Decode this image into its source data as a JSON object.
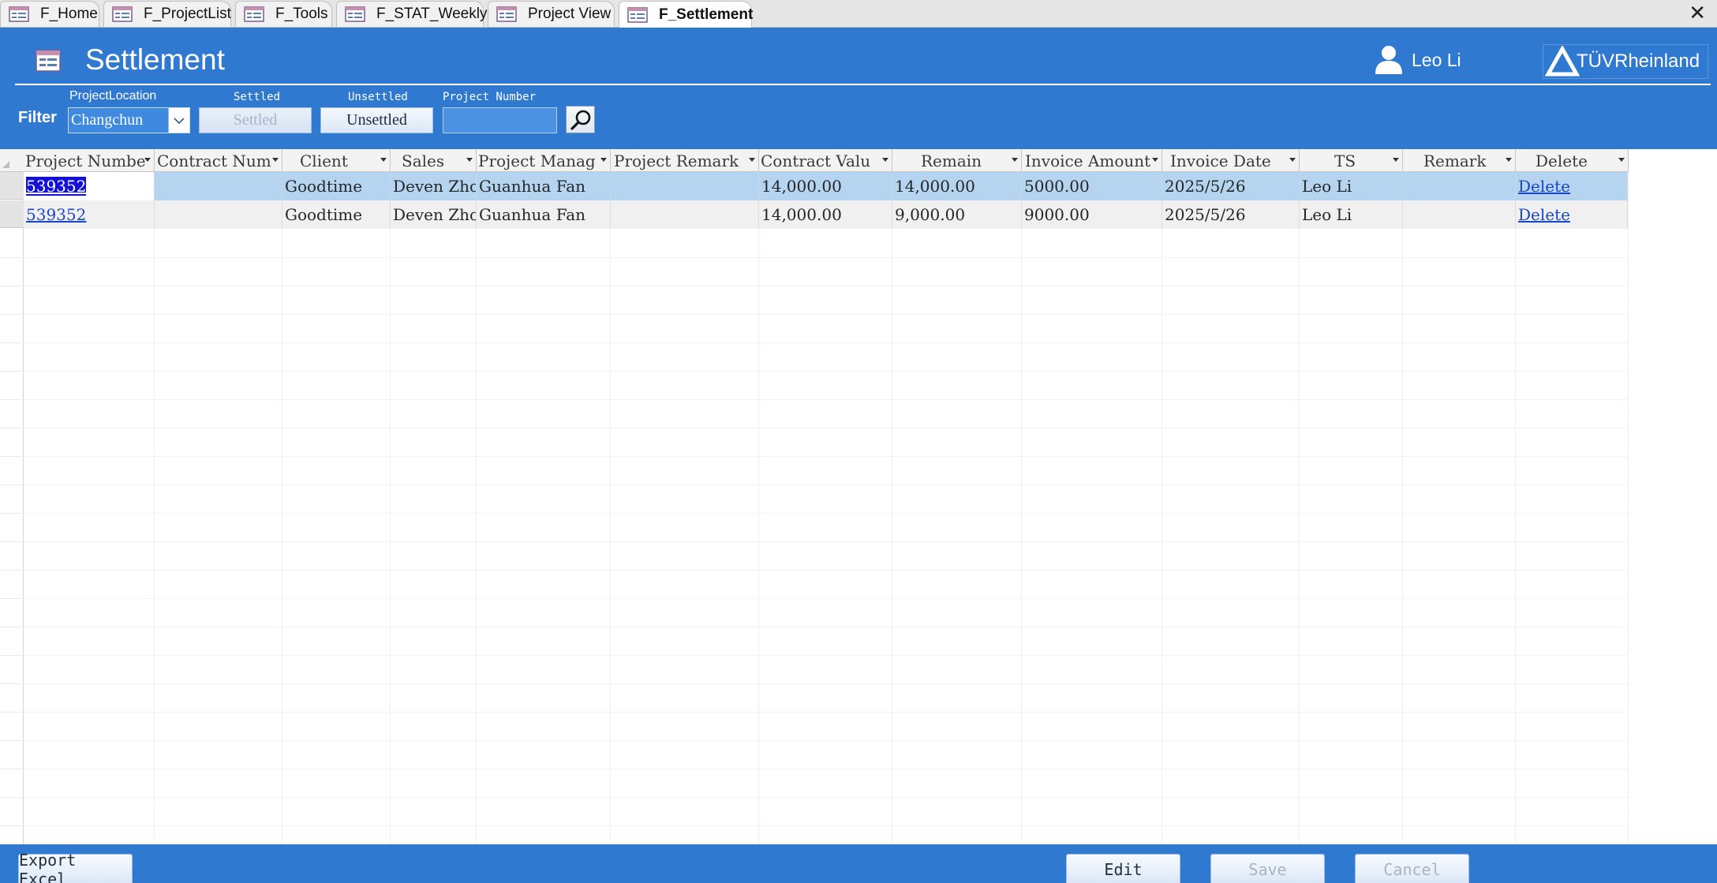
{
  "tabs": [
    {
      "label": "F_Home"
    },
    {
      "label": "F_ProjectList"
    },
    {
      "label": "F_Tools"
    },
    {
      "label": "F_STAT_Weekly"
    },
    {
      "label": "Project View"
    },
    {
      "label": "F_Settlement"
    }
  ],
  "active_tab": "F_Settlement",
  "close_label": "✕",
  "header": {
    "title": "Settlement",
    "user_name": "Leo Li",
    "logo_text": "TÜVRheinland",
    "accent_color": "#2f79d0"
  },
  "filter": {
    "label": "Filter",
    "location_label": "ProjectLocation",
    "location_value": "Changchun",
    "settled_caption": "Settled",
    "settled_button": "Settled",
    "unsettled_caption": "Unsettled",
    "unsettled_button": "Unsettled",
    "project_number_caption": "Project Number",
    "project_number_value": ""
  },
  "columns": [
    "Project Numbe",
    "Contract Num",
    "Client",
    "Sales",
    "Project Manag",
    "Project Remark",
    "Contract Valu",
    "Remain",
    "Invoice Amount",
    "Invoice Date",
    "TS",
    "Remark",
    "Delete"
  ],
  "rows": [
    {
      "project_number": "539352",
      "contract_num": "",
      "client": "Goodtime",
      "sales": "Deven Zhou",
      "project_manager": "Guanhua Fan",
      "project_remark": "",
      "contract_value": "14,000.00",
      "remain": "14,000.00",
      "invoice_amount": "5000.00",
      "invoice_date": "2025/5/26",
      "ts": "Leo Li",
      "remark": "",
      "delete": "Delete"
    },
    {
      "project_number": "539352",
      "contract_num": "",
      "client": "Goodtime",
      "sales": "Deven Zhou",
      "project_manager": "Guanhua Fan",
      "project_remark": "",
      "contract_value": "14,000.00",
      "remain": "9,000.00",
      "invoice_amount": "9000.00",
      "invoice_date": "2025/5/26",
      "ts": "Leo Li",
      "remark": "",
      "delete": "Delete"
    }
  ],
  "footer": {
    "export_label": "Export Excel",
    "edit_label": "Edit",
    "save_label": "Save",
    "cancel_label": "Cancel"
  }
}
